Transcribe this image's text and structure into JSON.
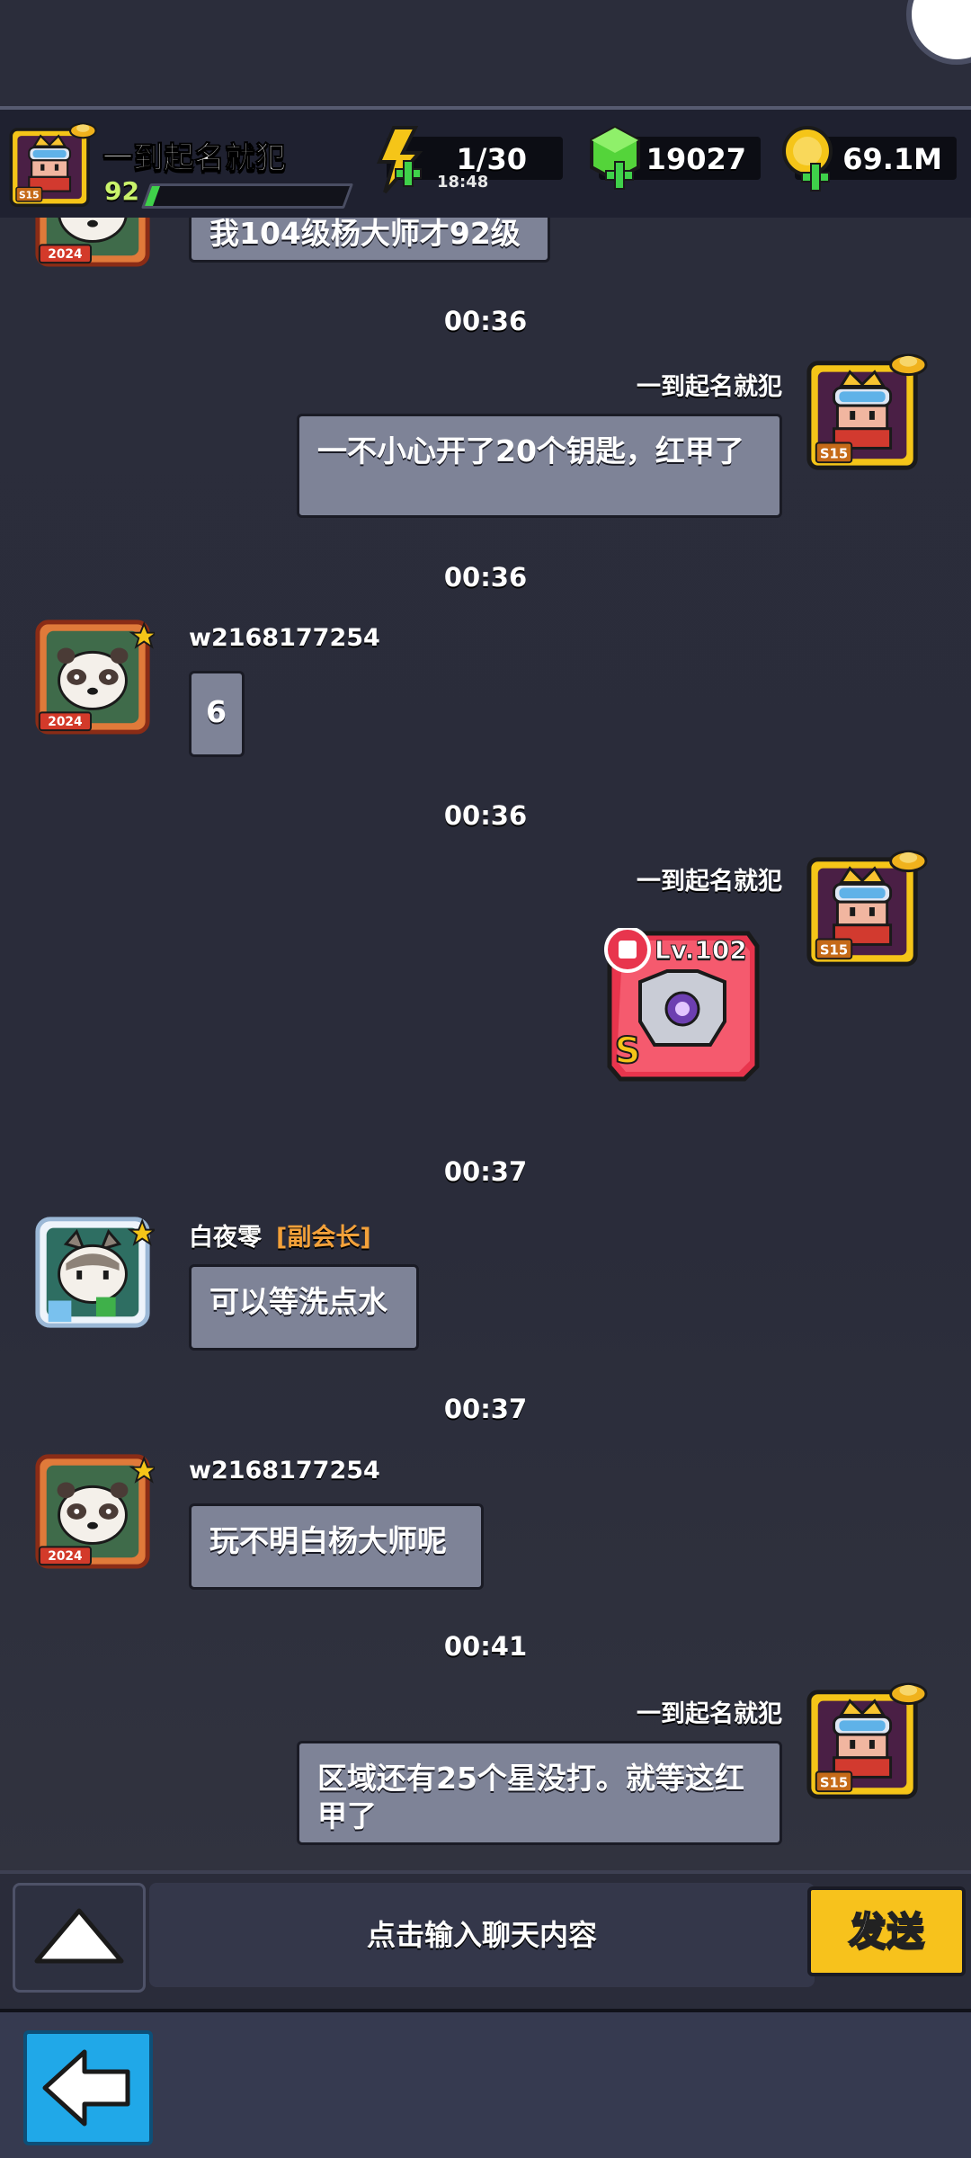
{
  "header": {
    "player_name": "一到起名就犯",
    "player_level": "92",
    "xp_fraction": 0.04,
    "energy": "1/30",
    "energy_timer": "18:48",
    "gems": "19027",
    "gold": "69.1M",
    "season_badge": "S15"
  },
  "chat": {
    "partial_message": "我104级杨大师才92级",
    "messages": [
      {
        "time": "00:36",
        "sender": "一到起名就犯",
        "text": "一不小心开了20个钥匙，红甲了",
        "side": "right"
      },
      {
        "time": "00:36",
        "sender": "w2168177254",
        "text": "6",
        "side": "left",
        "badge": "2024"
      },
      {
        "time": "00:36",
        "sender": "一到起名就犯",
        "item": {
          "level": "Lv.102",
          "grade": "S"
        },
        "side": "right"
      },
      {
        "time": "00:37",
        "sender": "白夜零",
        "role": "[副会长]",
        "text": "可以等洗点水",
        "side": "left"
      },
      {
        "time": "00:37",
        "sender": "w2168177254",
        "text": "玩不明白杨大师呢",
        "side": "left",
        "badge": "2024"
      },
      {
        "time": "00:41",
        "sender": "一到起名就犯",
        "text": "区域还有25个星没打。就等这红甲了",
        "side": "right"
      }
    ]
  },
  "input": {
    "placeholder": "点击输入聊天内容",
    "send_label": "发送"
  },
  "colors": {
    "background": "#2b2d3b",
    "bubble": "#7e8397",
    "send_button": "#f7c21c",
    "back_button": "#20a8e8",
    "role": "#f3a13a"
  }
}
